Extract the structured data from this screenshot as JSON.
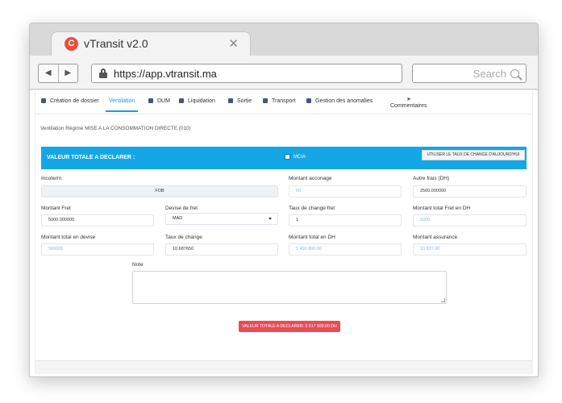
{
  "browser": {
    "tab_title": "vTransit v2.0",
    "tab_logo_letter": "C",
    "tab_close": "✕",
    "url": "https://app.vtransit.ma",
    "search_placeholder": "Search",
    "back_glyph": "◀",
    "forward_glyph": "▶"
  },
  "nav": {
    "items": [
      {
        "label": "Création de dossier",
        "icon": "folder-icon"
      },
      {
        "label": "Ventilation",
        "icon": "",
        "active": true
      },
      {
        "label": "DUM",
        "icon": "shield-icon"
      },
      {
        "label": "Liquidation",
        "icon": "car-icon"
      },
      {
        "label": "Sortie",
        "icon": "gear-icon"
      },
      {
        "label": "Transport",
        "icon": "bus-icon"
      },
      {
        "label": "Gestion des anomalies",
        "icon": "calendar-icon"
      },
      {
        "label": "Commentaires",
        "icon": "paper-plane-icon"
      }
    ],
    "accent_color": "#1a9be0"
  },
  "page": {
    "subtitle": "Ventilation Régime MISE A LA CONSOMMATION DIRECTE (010)",
    "banner_title": "VALEUR TOTALE A DECLARER :",
    "banner_color": "#13a7e7",
    "mcia_label": "MCIA",
    "rate_button": "UTILISER LE TAUX DE CHANGE D'AUJOURD'HUI"
  },
  "fields": {
    "incoterm": {
      "label": "Incoterm",
      "value": "FOB"
    },
    "montant_acconage": {
      "label": "Montant acconage",
      "value": "00"
    },
    "autre_frais": {
      "label": "Autre frais (DH)",
      "value": "2500.000000"
    },
    "montant_fret": {
      "label": "Montant Fret",
      "value": "5000.000000"
    },
    "devise_fret": {
      "label": "Devise de fret",
      "value": "MAD"
    },
    "taux_change_fret": {
      "label": "Taux de change fret",
      "value": "1"
    },
    "montant_total_fret_dh": {
      "label": "Montant total Fret en DH",
      "value": "5000"
    },
    "montant_total_devise": {
      "label": "Montant total en devise",
      "value": "500000"
    },
    "taux_change": {
      "label": "Taux de change",
      "value": "10.687650"
    },
    "montant_total_dh": {
      "label": "Montant total en DH",
      "value": "5 490 800.00"
    },
    "montant_assurance": {
      "label": "Montant assurance",
      "value": "10 837.00"
    },
    "note": {
      "label": "Note",
      "value": ""
    }
  },
  "total_button": {
    "label": "VALEUR TOTALE A DECLARER: 5 517 939.00 DH",
    "color": "#e94b57"
  }
}
